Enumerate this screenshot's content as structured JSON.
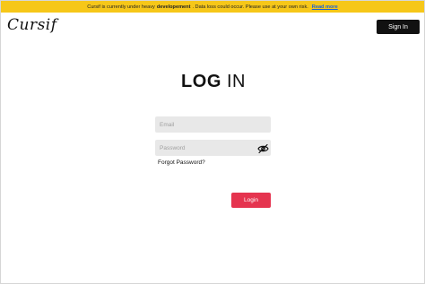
{
  "banner": {
    "text_before": "Cursif is currently under heavy",
    "bold": "developement",
    "text_after": ". Data loss could occur. Please use at your own risk.",
    "link": "Read more",
    "background": "#f6c719"
  },
  "header": {
    "logo": "Cursif",
    "signin_label": "Sign In"
  },
  "form": {
    "title_bold": "LOG",
    "title_rest": "IN",
    "email_placeholder": "Email",
    "password_placeholder": "Password",
    "password_toggle_icon": "eye-slash-icon",
    "forgot_label": "Forgot Password?",
    "login_label": "Login",
    "accent": "#e5344f"
  }
}
